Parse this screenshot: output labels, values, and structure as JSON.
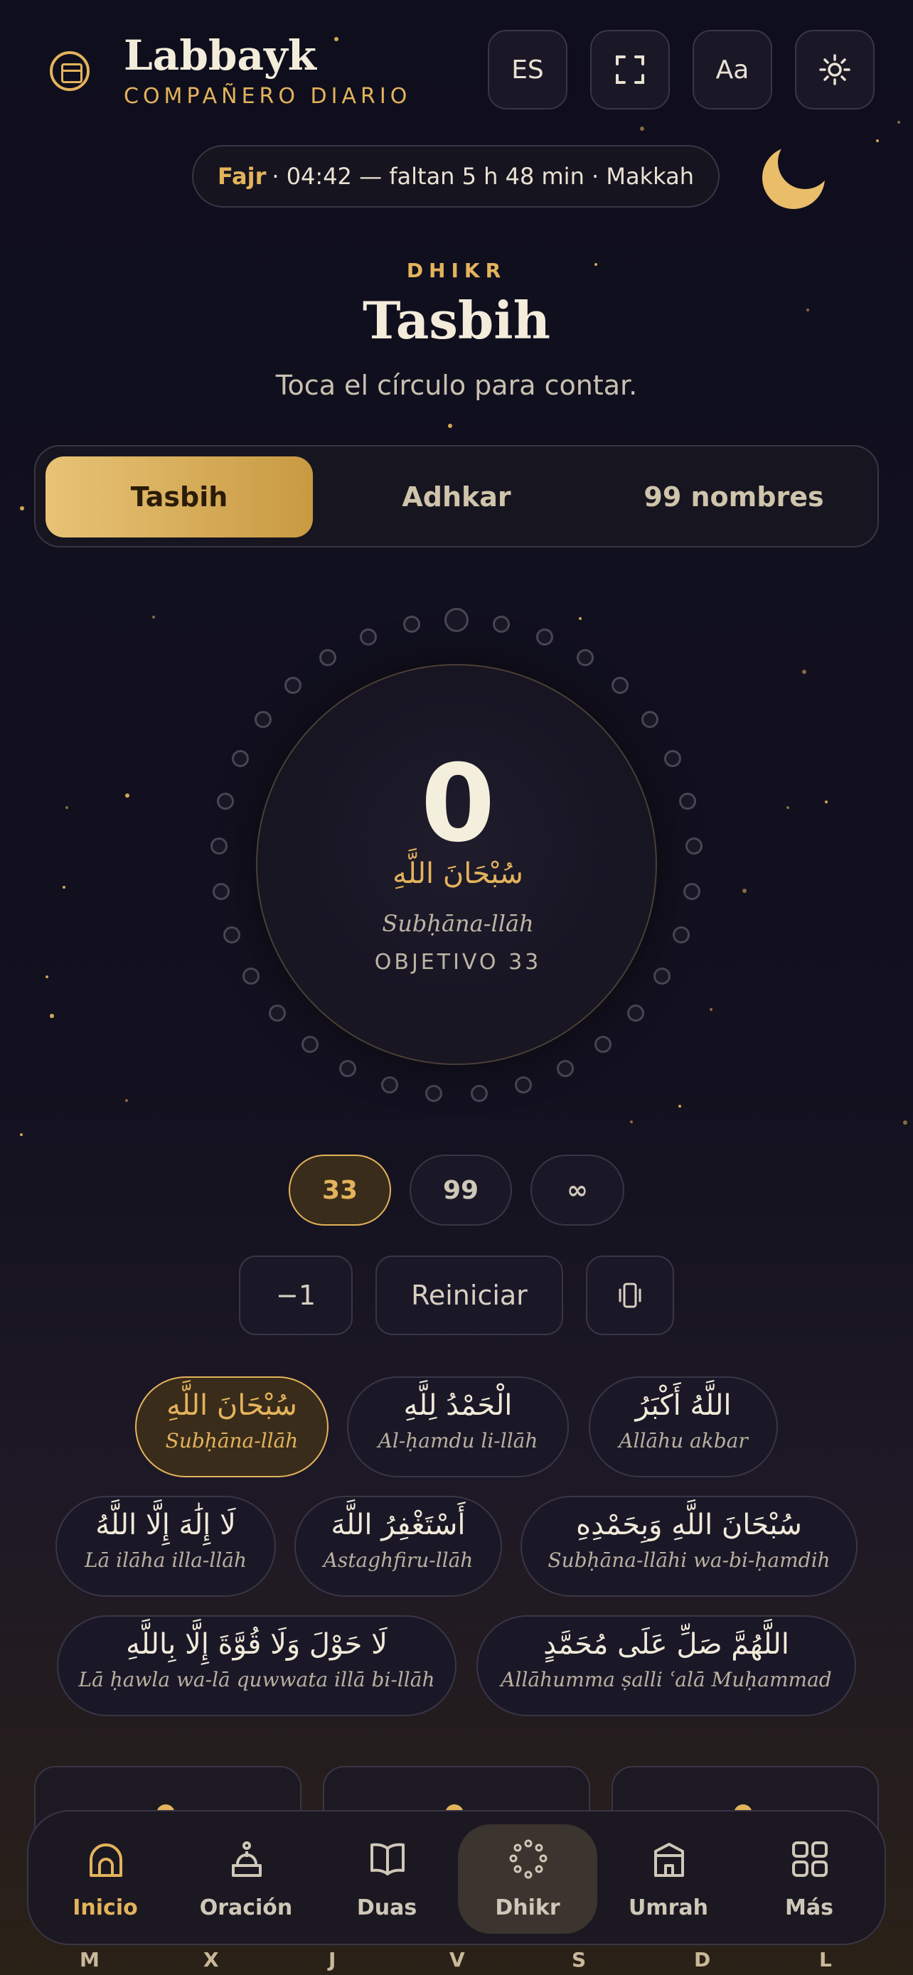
{
  "brand": {
    "title": "Labbayk",
    "subtitle": "COMPAÑERO DIARIO"
  },
  "header_buttons": {
    "language": "ES",
    "fullscreen": "fullscreen",
    "font_size": "Aa",
    "theme": "sun"
  },
  "prayer": {
    "name": "Fajr",
    "details": "· 04:42 — faltan 5 h 48 min · Makkah"
  },
  "section": {
    "eyebrow": "DHIKR",
    "title": "Tasbih",
    "subtitle": "Toca el círculo para contar."
  },
  "tabs": [
    {
      "label": "Tasbih",
      "active": true
    },
    {
      "label": "Adhkar",
      "active": false
    },
    {
      "label": "99 nombres",
      "active": false
    }
  ],
  "counter": {
    "value": "0",
    "arabic": "سُبْحَانَ اللَّهِ",
    "transliteration": "Subḥāna-llāh",
    "goal": "OBJETIVO 33",
    "progress": 0
  },
  "targets": [
    {
      "label": "33",
      "active": true
    },
    {
      "label": "99",
      "active": false
    },
    {
      "label": "∞",
      "active": false
    }
  ],
  "controls": {
    "minus": "−1",
    "reset": "Reiniciar",
    "vibrate": "vibrate"
  },
  "phrases": [
    {
      "ar": "سُبْحَانَ اللَّهِ",
      "tr": "Subḥāna-llāh",
      "active": true
    },
    {
      "ar": "الْحَمْدُ لِلَّهِ",
      "tr": "Al-ḥamdu li-llāh",
      "active": false
    },
    {
      "ar": "اللَّهُ أَكْبَرُ",
      "tr": "Allāhu akbar",
      "active": false
    },
    {
      "ar": "لَا إِلَٰهَ إِلَّا اللَّهُ",
      "tr": "Lā ilāha illa-llāh",
      "active": false
    },
    {
      "ar": "أَسْتَغْفِرُ اللَّهَ",
      "tr": "Astaghfiru-llāh",
      "active": false
    },
    {
      "ar": "سُبْحَانَ اللَّهِ وَبِحَمْدِهِ",
      "tr": "Subḥāna-llāhi wa-bi-ḥamdih",
      "active": false
    },
    {
      "ar": "لَا حَوْلَ وَلَا قُوَّةَ إِلَّا بِاللَّهِ",
      "tr": "Lā ḥawla wa-lā quwwata illā bi-llāh",
      "active": false
    },
    {
      "ar": "اللَّهُمَّ صَلِّ عَلَى مُحَمَّدٍ",
      "tr": "Allāhumma ṣalli ʿalā Muḥammad",
      "active": false
    }
  ],
  "nav": [
    {
      "label": "Inicio",
      "icon": "mosque-icon",
      "active": false
    },
    {
      "label": "Oración",
      "icon": "prayer-icon",
      "active": false
    },
    {
      "label": "Duas",
      "icon": "book-icon",
      "active": false
    },
    {
      "label": "Dhikr",
      "icon": "beads-icon",
      "active": true
    },
    {
      "label": "Umrah",
      "icon": "kaaba-icon",
      "active": false
    },
    {
      "label": "Más",
      "icon": "grid-icon",
      "active": false
    }
  ],
  "week_days": [
    "M",
    "X",
    "J",
    "V",
    "S",
    "D",
    "L"
  ],
  "colors": {
    "accent": "#e3b35c",
    "background": "#0f0e1d",
    "surface": "#1a1827",
    "border": "#3a3545"
  }
}
